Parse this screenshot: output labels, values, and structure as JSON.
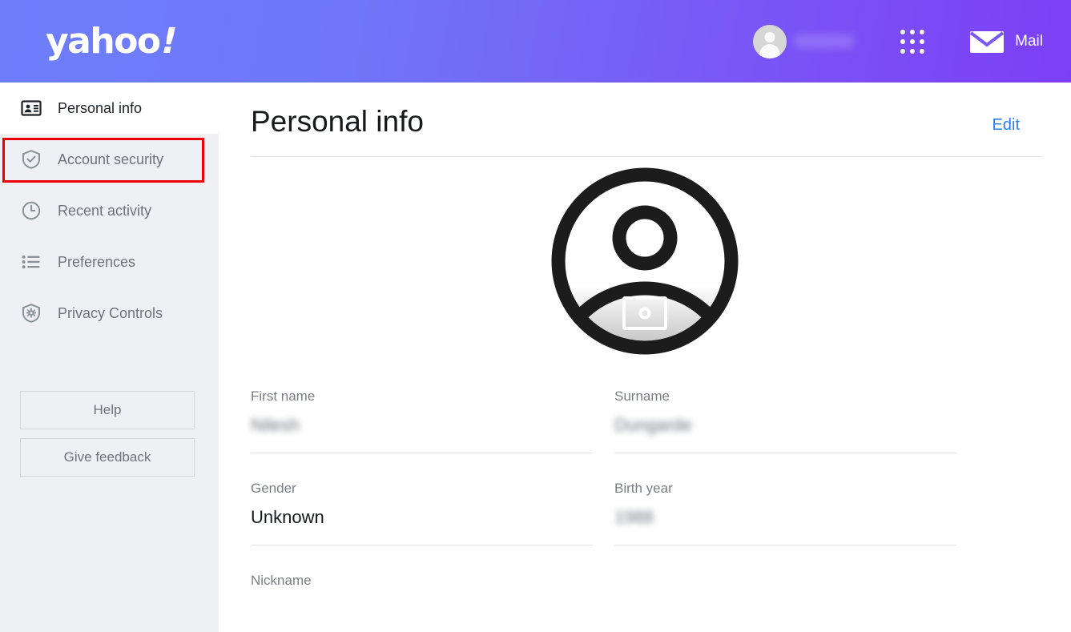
{
  "header": {
    "logo_text": "yahoo",
    "logo_bang": "!",
    "username_redacted": "",
    "apps_icon": "apps-grid-icon",
    "avatar_icon": "user-avatar-icon",
    "mail_icon": "envelope-icon",
    "mail_label": "Mail",
    "gradient_from": "#6e7efb",
    "gradient_to": "#7c3ff5"
  },
  "sidebar": {
    "items": [
      {
        "label": "Personal info",
        "icon": "id-card-icon",
        "active": true
      },
      {
        "label": "Account security",
        "icon": "shield-check-icon",
        "active": false
      },
      {
        "label": "Recent activity",
        "icon": "clock-icon",
        "active": false
      },
      {
        "label": "Preferences",
        "icon": "list-icon",
        "active": false
      },
      {
        "label": "Privacy Controls",
        "icon": "shield-gear-icon",
        "active": false
      }
    ],
    "highlight": {
      "target": "Account security",
      "color": "#ee0000"
    },
    "help_label": "Help",
    "feedback_label": "Give feedback"
  },
  "main": {
    "title": "Personal info",
    "edit_label": "Edit",
    "edit_color": "#2a7df4",
    "avatar": {
      "icon": "profile-photo-placeholder-icon",
      "camera_icon": "camera-icon"
    },
    "fields": [
      {
        "label": "First name",
        "value": "Nilesh",
        "redacted": true
      },
      {
        "label": "Surname",
        "value": "Dungarde",
        "redacted": true
      },
      {
        "label": "Gender",
        "value": "Unknown",
        "redacted": false
      },
      {
        "label": "Birth year",
        "value": "1988",
        "redacted": true
      },
      {
        "label": "Nickname",
        "value": "",
        "redacted": false
      }
    ]
  }
}
